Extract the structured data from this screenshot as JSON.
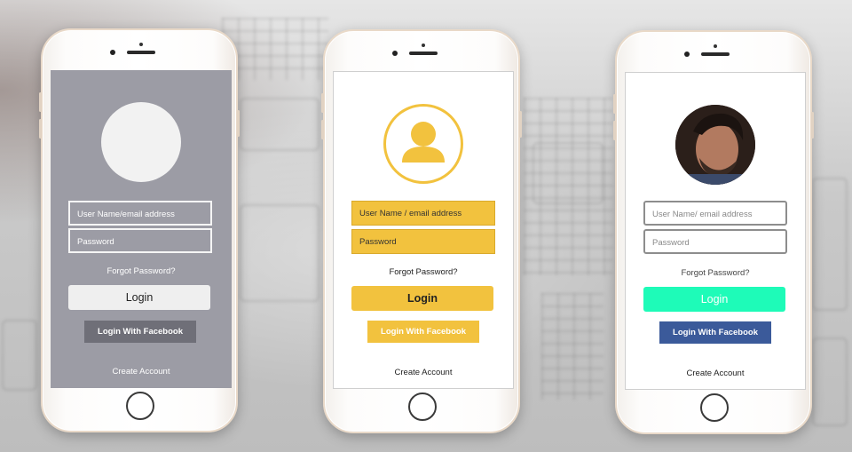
{
  "phones": [
    {
      "theme": "gray",
      "username_placeholder": "User Name/email address",
      "password_placeholder": "Password",
      "forgot_label": "Forgot Password?",
      "login_label": "Login",
      "facebook_label": "Login With Facebook",
      "create_label": "Create Account"
    },
    {
      "theme": "yellow",
      "username_placeholder": "User Name / email address",
      "password_placeholder": "Password",
      "forgot_label": "Forgot Password?",
      "login_label": "Login",
      "facebook_label": "Login With Facebook",
      "create_label": "Create Account"
    },
    {
      "theme": "photo",
      "username_placeholder": "User Name/ email address",
      "password_placeholder": "Password",
      "forgot_label": "Forgot Password?",
      "login_label": "Login",
      "facebook_label": "Login With Facebook",
      "create_label": "Create Account"
    }
  ],
  "colors": {
    "gray_screen": "#9c9ca5",
    "yellow_accent": "#f2c23e",
    "teal_accent": "#1efbb8",
    "facebook_blue": "#3b5a9a"
  },
  "icons": {
    "default_avatar": "avatar-placeholder-icon",
    "user_avatar": "user-silhouette-icon",
    "photo_avatar": "profile-photo"
  }
}
